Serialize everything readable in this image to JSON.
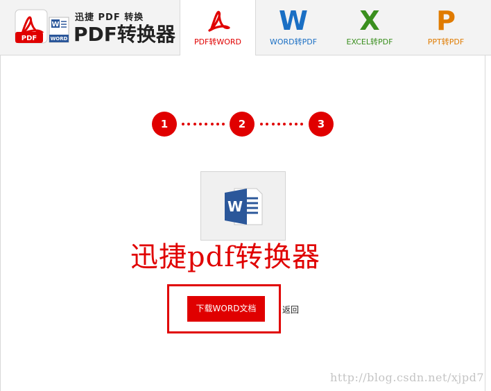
{
  "header": {
    "logo": {
      "subtitle": "迅捷 PDF 转换",
      "title": "PDF转换器",
      "pdf_badge": "PDF",
      "word_badge": "WORD"
    },
    "tabs": [
      {
        "glyph": "",
        "label": "PDF转WORD",
        "color": "#e00000",
        "active": true,
        "icon": "acrobat-icon"
      },
      {
        "glyph": "W",
        "label": "WORD转PDF",
        "color": "#1a6fc4",
        "active": false,
        "icon": "word-icon"
      },
      {
        "glyph": "X",
        "label": "EXCEL转PDF",
        "color": "#3a8f1e",
        "active": false,
        "icon": "excel-icon"
      },
      {
        "glyph": "P",
        "label": "PPT转PDF",
        "color": "#e07b00",
        "active": false,
        "icon": "powerpoint-icon"
      }
    ]
  },
  "steps": [
    "1",
    "2",
    "3"
  ],
  "file_preview": {
    "icon": "word-document-icon",
    "glyph": "W"
  },
  "overlay_title": "迅捷pdf转换器",
  "actions": {
    "download_label": "下载WORD文档",
    "back_label": "返回"
  },
  "watermark": "http://blog.csdn.net/xjpd7",
  "colors": {
    "accent": "#e00000",
    "word_blue": "#2b579a"
  }
}
